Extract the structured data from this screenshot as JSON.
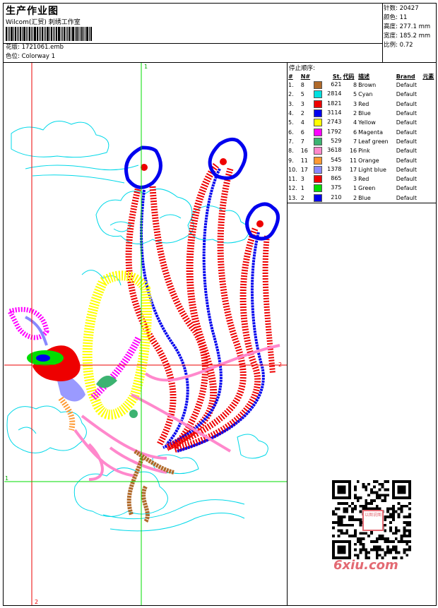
{
  "header": {
    "title": "生产作业图",
    "company": "Wilcom(汇贸) 刺绣工作室",
    "design_label": "花版:",
    "design_value": "1721061.emb",
    "colorway_label": "色位:",
    "colorway_value": "Colorway 1"
  },
  "stats": [
    {
      "label": "针数:",
      "value": "20427"
    },
    {
      "label": "颜色:",
      "value": "11"
    },
    {
      "label": "高度:",
      "value": "277.1 mm"
    },
    {
      "label": "宽度:",
      "value": "185.2 mm"
    },
    {
      "label": "比例:",
      "value": "0.72"
    }
  ],
  "stop_sequence": {
    "title": "停止顺序:",
    "headers": [
      "#",
      "N#",
      "St.",
      "代码",
      "描述",
      "Brand",
      "元素"
    ],
    "rows": [
      {
        "idx": "1.",
        "n": "8",
        "color": "#b06a2a",
        "st": "621",
        "code": "8",
        "desc": "Brown",
        "brand": "Default"
      },
      {
        "idx": "2.",
        "n": "5",
        "color": "#00e0e0",
        "st": "2814",
        "code": "5",
        "desc": "Cyan",
        "brand": "Default"
      },
      {
        "idx": "3.",
        "n": "3",
        "color": "#ee0000",
        "st": "1821",
        "code": "3",
        "desc": "Red",
        "brand": "Default"
      },
      {
        "idx": "4.",
        "n": "2",
        "color": "#0000ee",
        "st": "3114",
        "code": "2",
        "desc": "Blue",
        "brand": "Default"
      },
      {
        "idx": "5.",
        "n": "4",
        "color": "#ffff00",
        "st": "2743",
        "code": "4",
        "desc": "Yellow",
        "brand": "Default"
      },
      {
        "idx": "6.",
        "n": "6",
        "color": "#ff00ff",
        "st": "1792",
        "code": "6",
        "desc": "Magenta",
        "brand": "Default"
      },
      {
        "idx": "7.",
        "n": "7",
        "color": "#3cb371",
        "st": "529",
        "code": "7",
        "desc": "Leaf green",
        "brand": "Default"
      },
      {
        "idx": "8.",
        "n": "16",
        "color": "#ff88cc",
        "st": "3618",
        "code": "16",
        "desc": "Pink",
        "brand": "Default"
      },
      {
        "idx": "9.",
        "n": "11",
        "color": "#ff9933",
        "st": "545",
        "code": "11",
        "desc": "Orange",
        "brand": "Default"
      },
      {
        "idx": "10.",
        "n": "17",
        "color": "#8888ff",
        "st": "1378",
        "code": "17",
        "desc": "Light blue",
        "brand": "Default"
      },
      {
        "idx": "11.",
        "n": "3",
        "color": "#ee0000",
        "st": "865",
        "code": "3",
        "desc": "Red",
        "brand": "Default"
      },
      {
        "idx": "12.",
        "n": "1",
        "color": "#00dd00",
        "st": "375",
        "code": "1",
        "desc": "Green",
        "brand": "Default"
      },
      {
        "idx": "13.",
        "n": "2",
        "color": "#0000ee",
        "st": "210",
        "code": "2",
        "desc": "Blue",
        "brand": "Default"
      }
    ]
  },
  "guides": {
    "v1": "1",
    "v2": "2",
    "h1": "1",
    "h2": "2"
  },
  "watermark": "6xiu.com",
  "seal_text": "以图说图"
}
